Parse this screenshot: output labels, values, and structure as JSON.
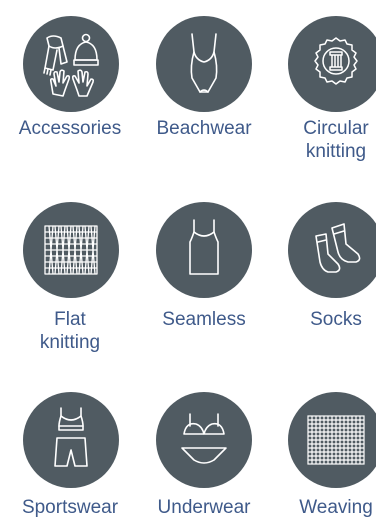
{
  "colors": {
    "circle": "#505b62",
    "label": "#3f5a8a",
    "line": "#ffffff"
  },
  "categories": [
    {
      "label_lines": [
        "Accessories"
      ],
      "icon": "scarf-hat-gloves-icon"
    },
    {
      "label_lines": [
        "Beachwear"
      ],
      "icon": "swimsuit-icon"
    },
    {
      "label_lines": [
        "Circular",
        "knitting"
      ],
      "icon": "thread-spool-icon"
    },
    {
      "label_lines": [
        "Flat",
        "knitting"
      ],
      "icon": "knit-fabric-icon"
    },
    {
      "label_lines": [
        "Seamless"
      ],
      "icon": "tank-dress-icon"
    },
    {
      "label_lines": [
        "Socks"
      ],
      "icon": "socks-icon"
    },
    {
      "label_lines": [
        "Sportswear"
      ],
      "icon": "sports-bra-shorts-icon"
    },
    {
      "label_lines": [
        "Underwear"
      ],
      "icon": "bra-briefs-icon"
    },
    {
      "label_lines": [
        "Weaving"
      ],
      "icon": "woven-fabric-icon"
    }
  ]
}
